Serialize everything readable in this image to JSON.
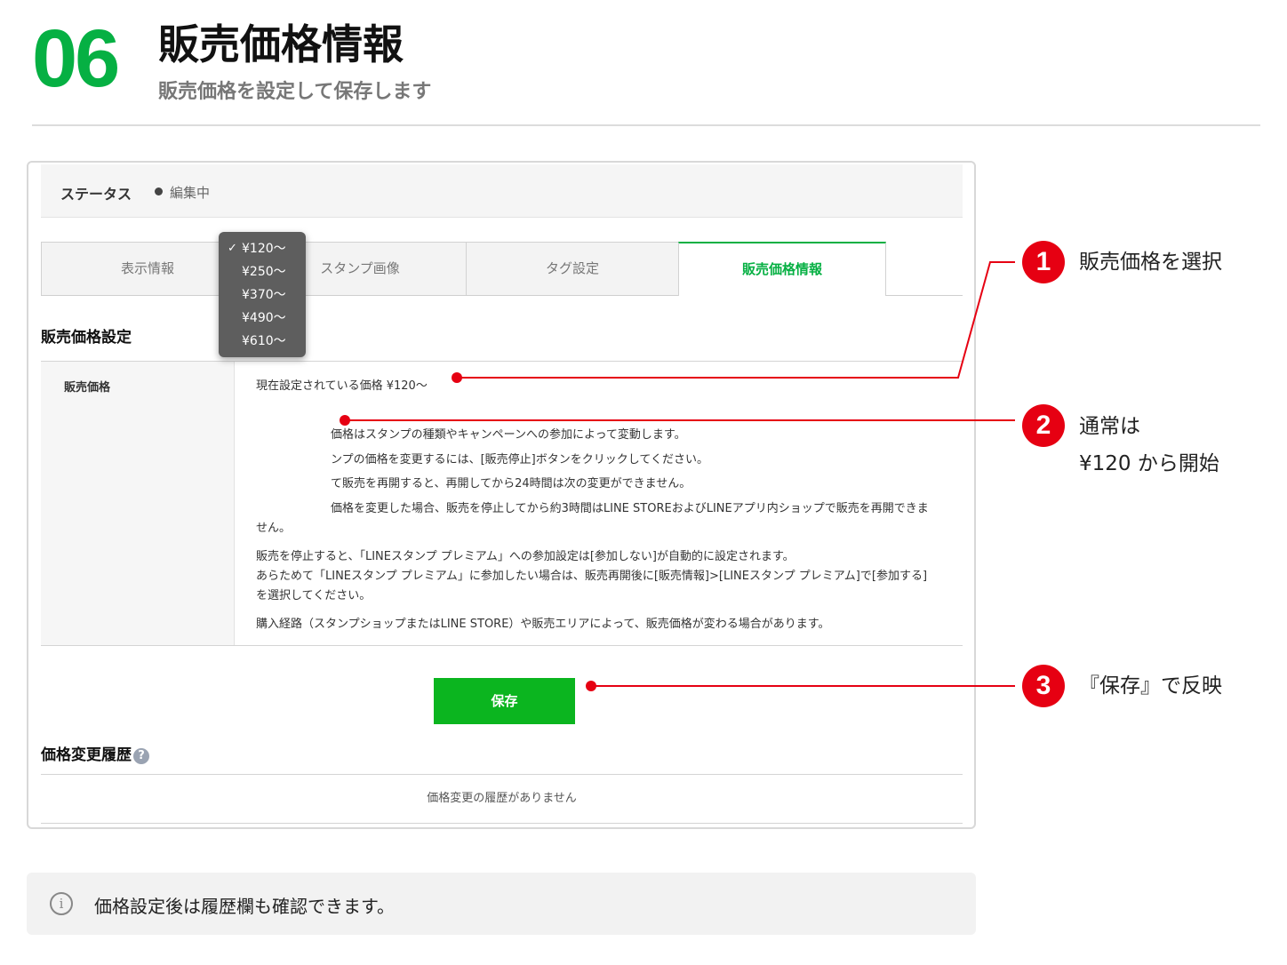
{
  "header": {
    "step_number": "06",
    "title": "販売価格情報",
    "subtitle": "販売価格を設定して保存します"
  },
  "status": {
    "label": "ステータス",
    "value": "編集中"
  },
  "tabs": [
    {
      "label": "表示情報",
      "active": false
    },
    {
      "label": "スタンプ画像",
      "active": false
    },
    {
      "label": "タグ設定",
      "active": false
    },
    {
      "label": "販売価格情報",
      "active": true
    }
  ],
  "price_section": {
    "title": "販売価格設定",
    "row_label": "販売価格",
    "current_price": "現在設定されている価格 ¥120〜",
    "notes": [
      "価格はスタンプの種類やキャンペーンへの参加によって変動します。",
      "ンプの価格を変更するには、[販売停止]ボタンをクリックしてください。",
      "て販売を再開すると、再開してから24時間は次の変更ができません。",
      "価格を変更した場合、販売を停止してから約3時間はLINE STOREおよびLINEアプリ内ショップで販売を再開できま",
      "せん。",
      "販売を停止すると、「LINEスタンプ プレミアム」への参加設定は[参加しない]が自動的に設定されます。",
      "あらためて「LINEスタンプ プレミアム」に参加したい場合は、販売再開後に[販売情報]>[LINEスタンプ プレミアム]で[参加する]",
      "を選択してください。",
      "購入経路（スタンプショップまたはLINE STORE）や販売エリアによって、販売価格が変わる場合があります。"
    ]
  },
  "price_dropdown": {
    "options": [
      "¥120〜",
      "¥250〜",
      "¥370〜",
      "¥490〜",
      "¥610〜"
    ],
    "selected": "¥120〜"
  },
  "save_button": "保存",
  "history": {
    "title": "価格変更履歴",
    "help_icon": "question-circle-icon",
    "empty_text": "価格変更の履歴がありません"
  },
  "info": {
    "icon": "info-circle-icon",
    "text": "価格設定後は履歴欄も確認できます。"
  },
  "callouts": [
    {
      "number": "1",
      "text": "販売価格を選択"
    },
    {
      "number": "2",
      "text_line1": "通常は",
      "text_line2": "¥120 から開始"
    },
    {
      "number": "3",
      "text": "『保存』で反映"
    }
  ],
  "colors": {
    "accent_green": "#06b043",
    "button_green": "#0bb51f",
    "callout_red": "#e60012"
  }
}
